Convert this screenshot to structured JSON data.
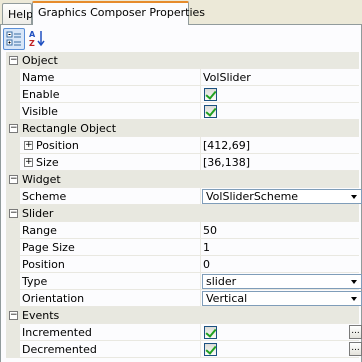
{
  "tabs": [
    {
      "label": "Help",
      "active": false
    },
    {
      "label": "Graphics Composer Properties",
      "active": true
    }
  ],
  "toolbar": {
    "categorized_icon": "categorized-view-icon",
    "alphabetical_icon": "alphabetical-sort-icon"
  },
  "categories": {
    "object": "Object",
    "rectangle_object": "Rectangle Object",
    "widget": "Widget",
    "slider": "Slider",
    "events": "Events"
  },
  "properties": {
    "name": {
      "label": "Name",
      "value": "VolSlider"
    },
    "enable": {
      "label": "Enable",
      "checked": true
    },
    "visible": {
      "label": "Visible",
      "checked": true
    },
    "position": {
      "label": "Position",
      "value": "[412,69]"
    },
    "size": {
      "label": "Size",
      "value": "[36,138]"
    },
    "scheme": {
      "label": "Scheme",
      "value": "VolSliderScheme"
    },
    "range": {
      "label": "Range",
      "value": "50"
    },
    "page_size": {
      "label": "Page Size",
      "value": "1"
    },
    "slider_position": {
      "label": "Position",
      "value": "0"
    },
    "type": {
      "label": "Type",
      "value": "slider"
    },
    "orientation": {
      "label": "Orientation",
      "value": "Vertical"
    },
    "incremented": {
      "label": "Incremented",
      "checked": true,
      "button": "..."
    },
    "decremented": {
      "label": "Decremented",
      "checked": true,
      "button": "..."
    }
  },
  "glyphs": {
    "collapse": "−",
    "expand": "+"
  }
}
